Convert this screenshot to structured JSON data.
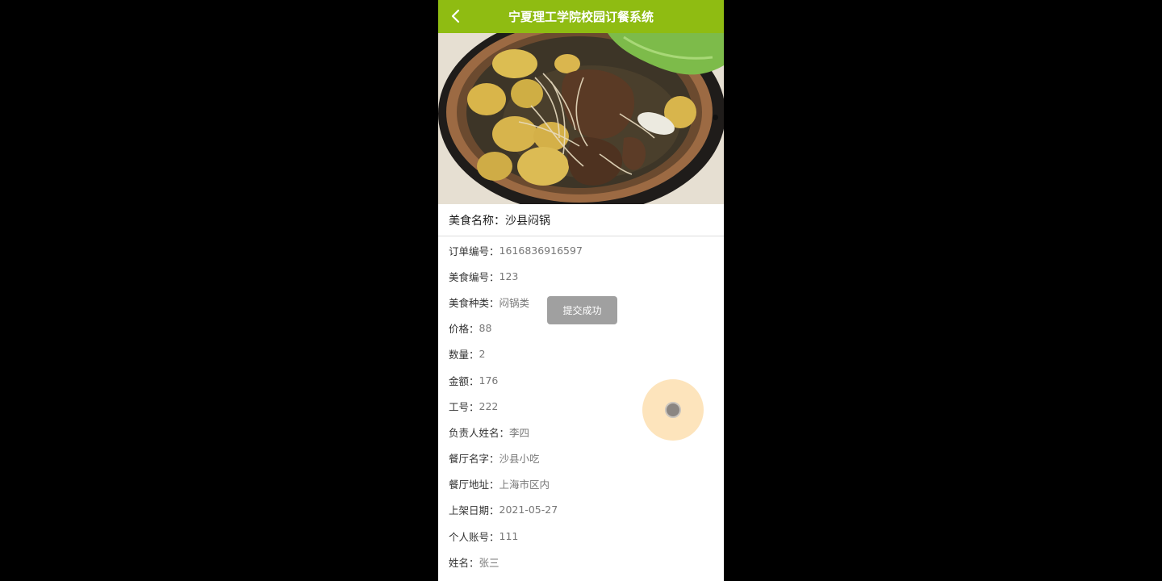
{
  "header": {
    "title": "宁夏理工学院校园订餐系统",
    "back_icon": "chevron-left-icon"
  },
  "banner": {
    "alt": "沙县闷锅",
    "active_slide": 1
  },
  "food_name": {
    "label": "美食名称：",
    "value": "沙县闷锅"
  },
  "details": [
    {
      "label": "订单编号：",
      "value": "1616836916597"
    },
    {
      "label": "美食编号：",
      "value": "123"
    },
    {
      "label": "美食种类：",
      "value": "闷锅类"
    },
    {
      "label": "价格：",
      "value": "88"
    },
    {
      "label": "数量：",
      "value": "2"
    },
    {
      "label": "金额：",
      "value": "176"
    },
    {
      "label": "工号：",
      "value": "222"
    },
    {
      "label": "负责人姓名：",
      "value": "李四"
    },
    {
      "label": "餐厅名字：",
      "value": "沙县小吃"
    },
    {
      "label": "餐厅地址：",
      "value": "上海市区内"
    },
    {
      "label": "上架日期：",
      "value": "2021-05-27"
    },
    {
      "label": "个人账号：",
      "value": "111"
    },
    {
      "label": "姓名：",
      "value": "张三"
    }
  ],
  "toast": {
    "text": "提交成功"
  },
  "colors": {
    "header_bg": "#8fbc12",
    "float_button_bg": "#fde4bc",
    "page_bg": "#000000"
  }
}
